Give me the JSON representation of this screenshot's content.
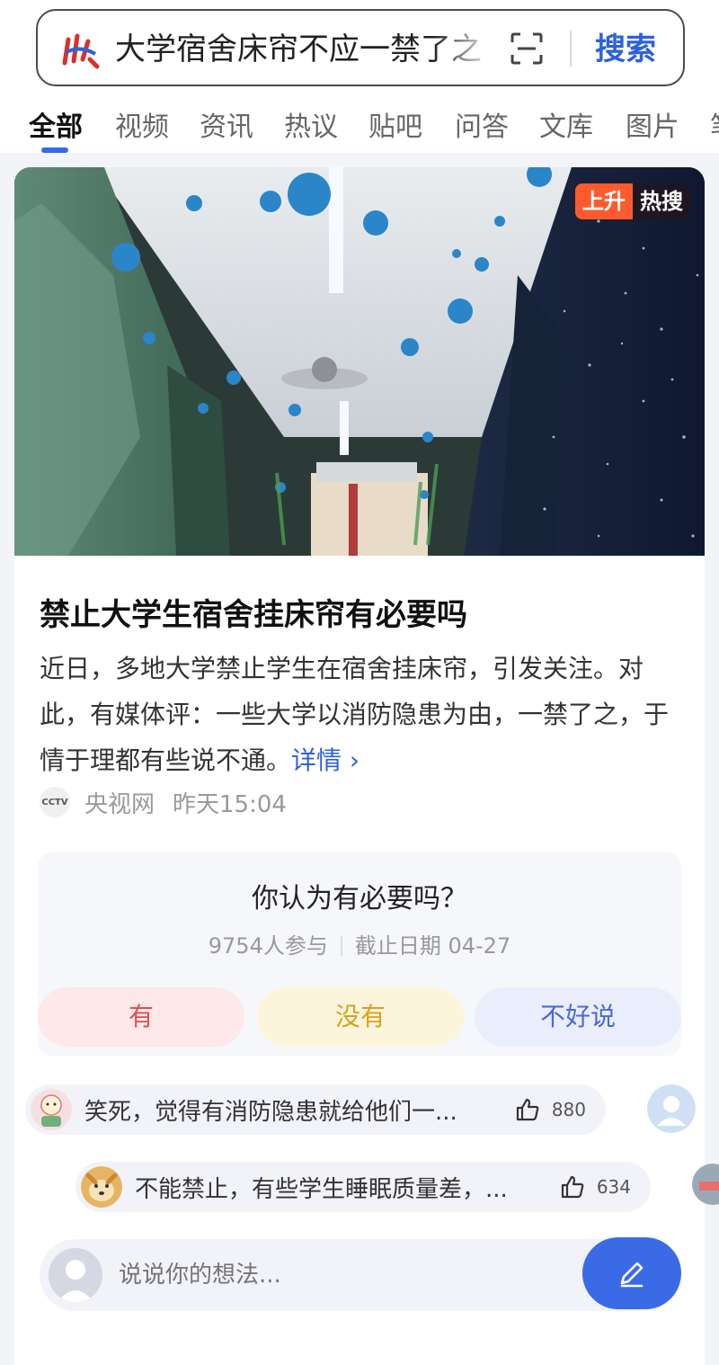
{
  "search": {
    "query": "大学宿舍床帘不应一禁了之",
    "button_label": "搜索"
  },
  "tabs": [
    {
      "label": "全部"
    },
    {
      "label": "视频"
    },
    {
      "label": "资讯"
    },
    {
      "label": "热议"
    },
    {
      "label": "贴吧"
    },
    {
      "label": "问答"
    },
    {
      "label": "文库"
    },
    {
      "label": "图片"
    },
    {
      "label": "笔"
    }
  ],
  "card": {
    "badge_a": "上升",
    "badge_b": "热搜",
    "title": "禁止大学生宿舍挂床帘有必要吗",
    "summary": "近日，多地大学禁止学生在宿舍挂床帘，引发关注。对此，有媒体评：一些大学以消防隐患为由，一禁了之，于情于理都有些说不通。",
    "more_label": "详情 ›",
    "source_logo": "CCTV",
    "source": "央视网",
    "time": "昨天15:04"
  },
  "poll": {
    "question": "你认为有必要吗？",
    "participants": "9754人参与",
    "deadline": "截止日期  04-27",
    "options": [
      {
        "label": "有"
      },
      {
        "label": "没有"
      },
      {
        "label": "不好说"
      }
    ]
  },
  "comments": [
    {
      "text": "笑死，觉得有消防隐患就给他们一...",
      "likes": "880"
    },
    {
      "text": "不能禁止，有些学生睡眠质量差，...",
      "likes": "634"
    }
  ],
  "composer": {
    "placeholder": "说说你的想法..."
  },
  "colors": {
    "accent": "#2c62d8",
    "hot": "#ff5a2e"
  }
}
